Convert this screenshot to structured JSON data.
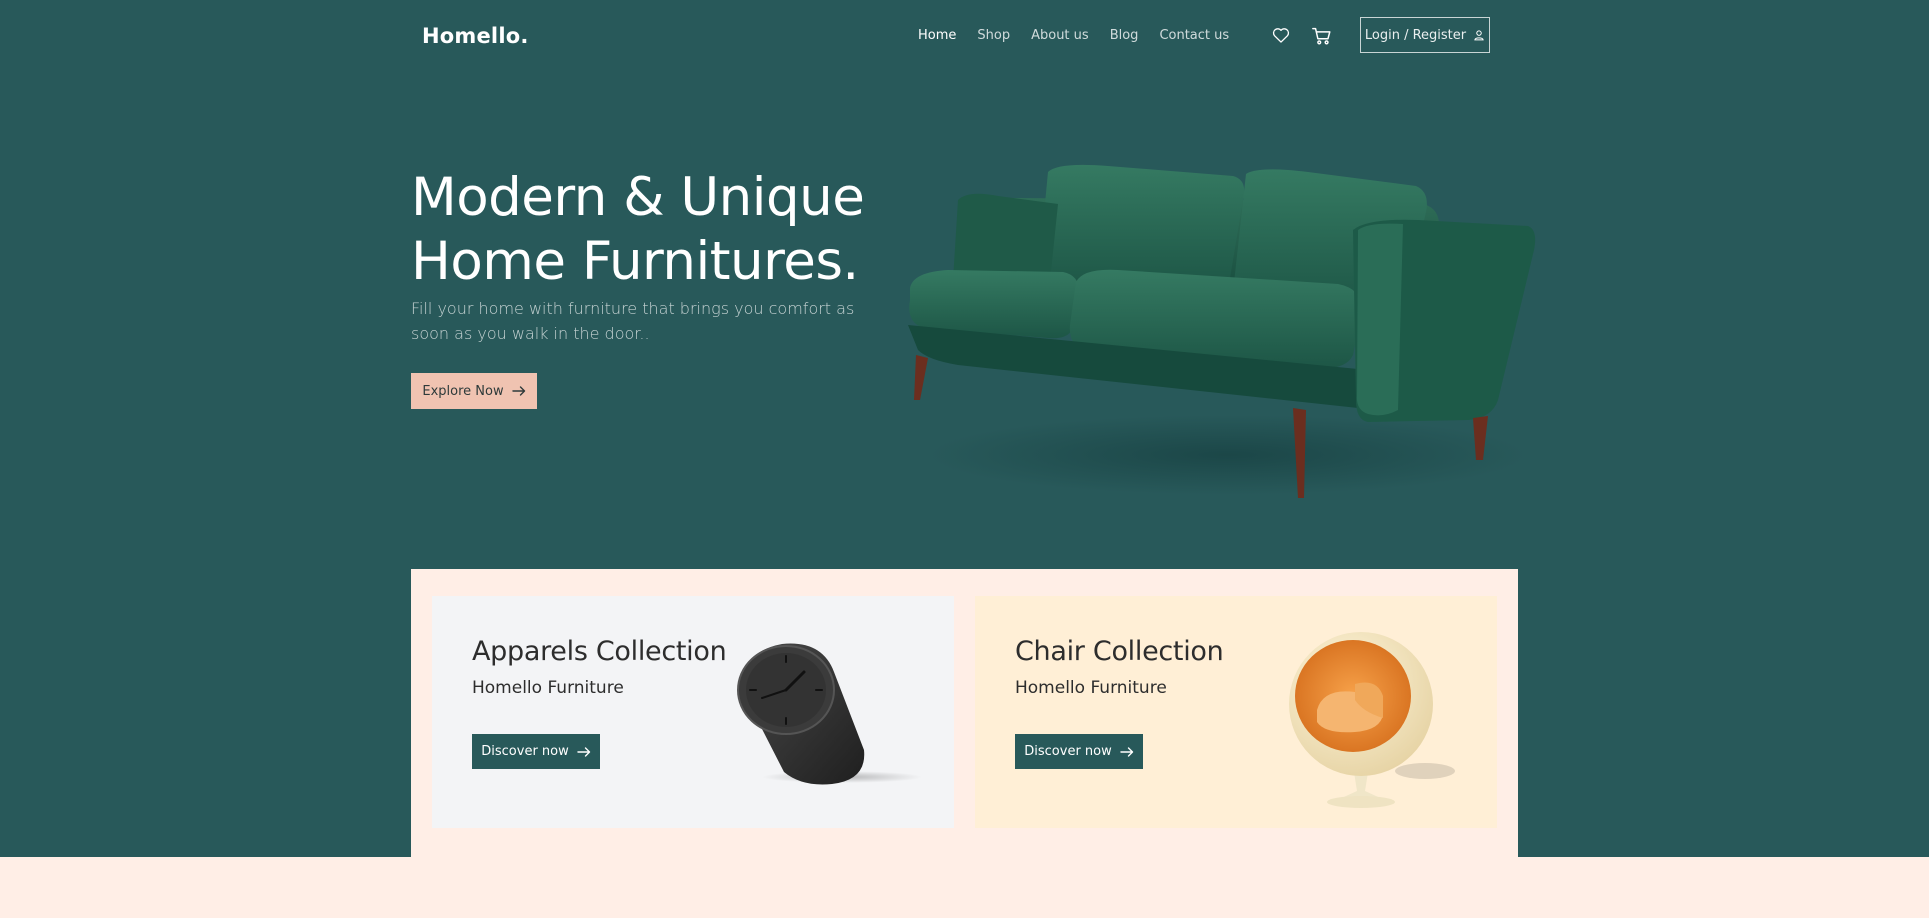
{
  "brand": "Homello.",
  "nav": {
    "items": [
      {
        "label": "Home",
        "active": true
      },
      {
        "label": "Shop",
        "active": false
      },
      {
        "label": "About us",
        "active": false
      },
      {
        "label": "Blog",
        "active": false
      },
      {
        "label": "Contact us",
        "active": false
      }
    ],
    "login_label": "Login / Register"
  },
  "icons": {
    "wishlist": "heart-icon",
    "cart": "cart-icon",
    "user": "user-icon",
    "arrow": "arrow-right-icon"
  },
  "hero": {
    "title_line1": "Modern & Unique",
    "title_line2": "Home Furnitures.",
    "subtitle": "Fill your home with furniture that brings you comfort as soon as you walk in the door..",
    "cta_label": "Explore Now"
  },
  "collections": [
    {
      "title": "Apparels Collection",
      "subtitle": "Homello Furniture",
      "cta_label": "Discover now"
    },
    {
      "title": "Chair Collection",
      "subtitle": "Homello Furniture",
      "cta_label": "Discover now"
    }
  ],
  "colors": {
    "primary": "#28595a",
    "accent": "#f0c3b1",
    "cream": "#ffeee6",
    "card_gray": "#f3f4f6",
    "card_yellow": "#ffefd6"
  }
}
